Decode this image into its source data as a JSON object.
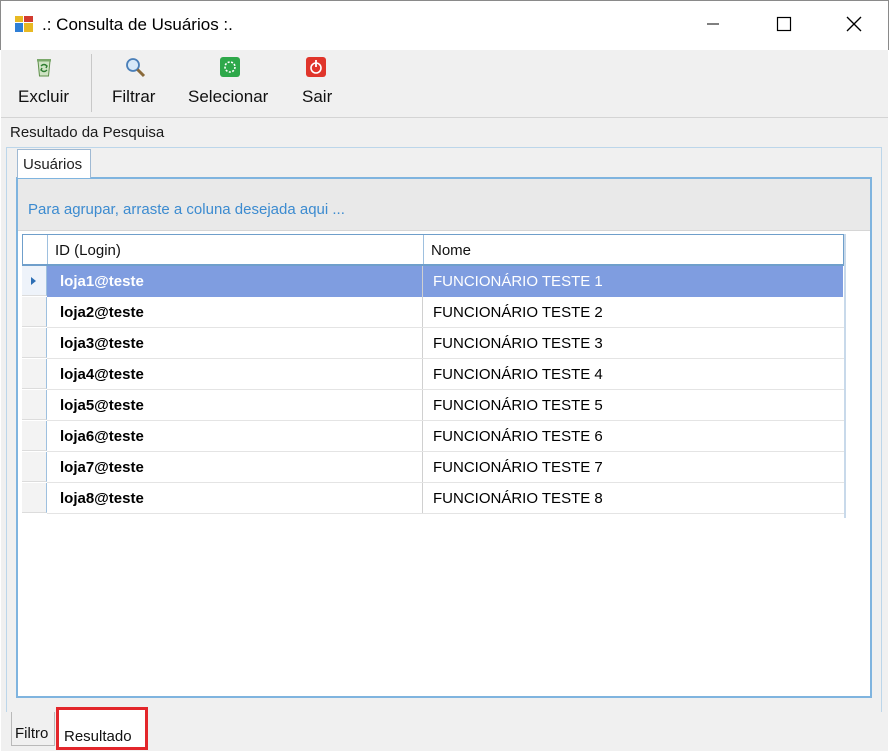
{
  "window": {
    "title": ".: Consulta de Usuários :."
  },
  "toolbar": {
    "excluir": "Excluir",
    "filtrar": "Filtrar",
    "selecionar": "Selecionar",
    "sair": "Sair"
  },
  "panel": {
    "group_title": "Resultado da Pesquisa",
    "tab_label": "Usuários",
    "group_hint": "Para agrupar, arraste a coluna desejada aqui ..."
  },
  "grid": {
    "columns": [
      "ID (Login)",
      "Nome"
    ],
    "rows": [
      {
        "id": "loja1@teste",
        "nome": "FUNCIONÁRIO TESTE 1"
      },
      {
        "id": "loja2@teste",
        "nome": "FUNCIONÁRIO TESTE 2"
      },
      {
        "id": "loja3@teste",
        "nome": "FUNCIONÁRIO TESTE 3"
      },
      {
        "id": "loja4@teste",
        "nome": "FUNCIONÁRIO TESTE 4"
      },
      {
        "id": "loja5@teste",
        "nome": "FUNCIONÁRIO TESTE 5"
      },
      {
        "id": "loja6@teste",
        "nome": "FUNCIONÁRIO TESTE 6"
      },
      {
        "id": "loja7@teste",
        "nome": "FUNCIONÁRIO TESTE 7"
      },
      {
        "id": "loja8@teste",
        "nome": "FUNCIONÁRIO TESTE 8"
      }
    ],
    "selected_row": 0
  },
  "bottom_tabs": {
    "filtro": "Filtro",
    "resultado": "Resultado"
  },
  "colors": {
    "selection": "#7f9de0",
    "hint_text": "#3c8bd0",
    "highlight_border": "#e3262b"
  },
  "icons": {
    "app": "app-window-icon",
    "excluir": "recycle-bin-icon",
    "filtrar": "magnifier-icon",
    "selecionar": "select-green-icon",
    "sair": "power-red-icon"
  }
}
